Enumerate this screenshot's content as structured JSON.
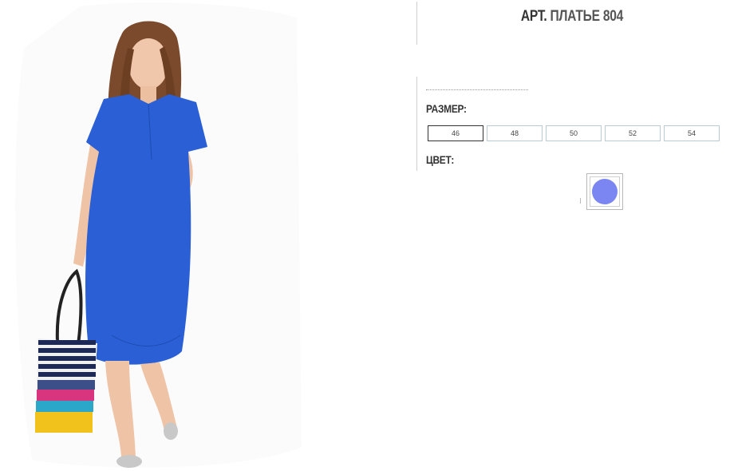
{
  "product": {
    "title_prefix": "АРТ.",
    "title_code": "ПЛАТЬЕ 804"
  },
  "sizes": {
    "label": "РАЗМЕР:",
    "options": [
      "46",
      "48",
      "50",
      "52",
      "54"
    ],
    "selected": "46"
  },
  "colors": {
    "label": "ЦВЕТ:",
    "swatches": [
      {
        "name": "blue-swatch",
        "color": "#7b86f2"
      }
    ]
  },
  "photo": {
    "dress_color": "#2a5fd6",
    "bag_stripes": [
      "#1e2a55",
      "#e8e8e8",
      "#d9357e",
      "#2aa7c9",
      "#f2c21c"
    ]
  }
}
